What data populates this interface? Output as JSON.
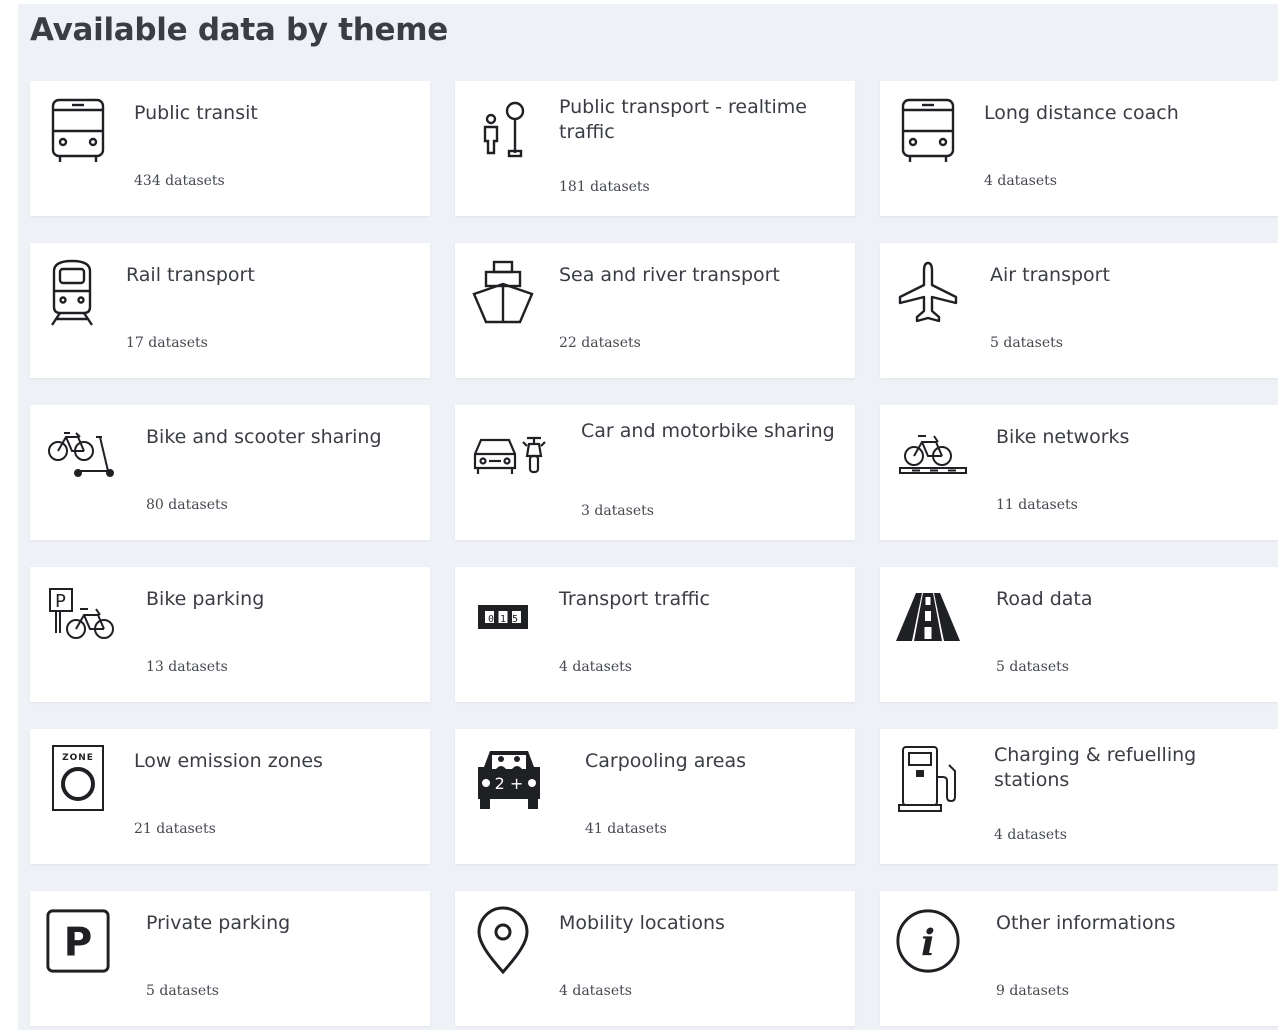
{
  "page": {
    "title": "Available data by theme"
  },
  "themes": [
    {
      "label": "Public transit",
      "count": "434 datasets",
      "icon": "bus-icon"
    },
    {
      "label": "Public transport - realtime traffic",
      "count": "181 datasets",
      "icon": "bus-stop-icon"
    },
    {
      "label": "Long distance coach",
      "count": "4 datasets",
      "icon": "coach-icon"
    },
    {
      "label": "Rail transport",
      "count": "17 datasets",
      "icon": "train-icon"
    },
    {
      "label": "Sea and river transport",
      "count": "22 datasets",
      "icon": "ship-icon"
    },
    {
      "label": "Air transport",
      "count": "5 datasets",
      "icon": "plane-icon"
    },
    {
      "label": "Bike and scooter sharing",
      "count": "80 datasets",
      "icon": "bike-scooter-icon"
    },
    {
      "label": "Car and motorbike sharing",
      "count": "3 datasets",
      "icon": "car-motorbike-icon"
    },
    {
      "label": "Bike networks",
      "count": "11 datasets",
      "icon": "bike-lane-icon"
    },
    {
      "label": "Bike parking",
      "count": "13 datasets",
      "icon": "bike-parking-icon"
    },
    {
      "label": "Transport traffic",
      "count": "4 datasets",
      "icon": "counter-icon"
    },
    {
      "label": "Road data",
      "count": "5 datasets",
      "icon": "road-icon"
    },
    {
      "label": "Low emission zones",
      "count": "21 datasets",
      "icon": "zone-sign-icon",
      "icon_text": "ZONE"
    },
    {
      "label": "Carpooling areas",
      "count": "41 datasets",
      "icon": "carpool-icon",
      "icon_text": "2 +"
    },
    {
      "label": "Charging & refuelling stations",
      "count": "4 datasets",
      "icon": "fuel-pump-icon"
    },
    {
      "label": "Private parking",
      "count": "5 datasets",
      "icon": "parking-sign-icon",
      "icon_text": "P"
    },
    {
      "label": "Mobility locations",
      "count": "4 datasets",
      "icon": "location-pin-icon"
    },
    {
      "label": "Other informations",
      "count": "9 datasets",
      "icon": "info-icon",
      "icon_text": "i"
    }
  ],
  "bike_parking_sign": "P",
  "counter_digits": "0 1 5",
  "colors": {
    "background": "#eef1f6",
    "card": "#ffffff",
    "text": "#3a3d44",
    "icon": "#1f2024"
  }
}
